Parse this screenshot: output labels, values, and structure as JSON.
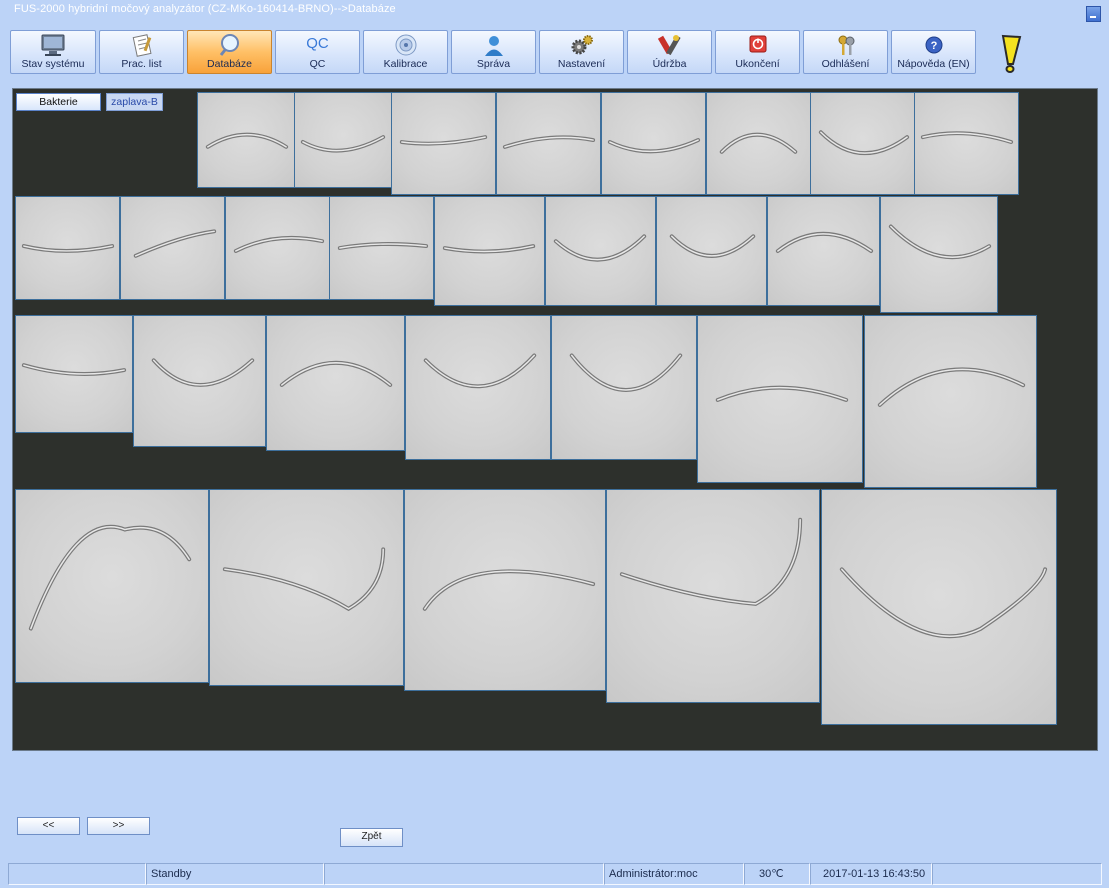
{
  "window": {
    "title": "FUS-2000 hybridní močový analyzátor (CZ-MKo-160414-BRNO)-->Databáze"
  },
  "toolbar": {
    "items": [
      {
        "label": "Stav systému",
        "icon": "monitor-icon"
      },
      {
        "label": "Prac. list",
        "icon": "worklist-icon"
      },
      {
        "label": "Databáze",
        "icon": "magnifier-icon",
        "active": true
      },
      {
        "label": "QC",
        "icon": "qc-icon"
      },
      {
        "label": "Kalibrace",
        "icon": "target-icon"
      },
      {
        "label": "Správa",
        "icon": "user-icon"
      },
      {
        "label": "Nastavení",
        "icon": "gears-icon"
      },
      {
        "label": "Údržba",
        "icon": "tools-icon"
      },
      {
        "label": "Ukončení",
        "icon": "power-icon"
      },
      {
        "label": "Odhlášení",
        "icon": "keys-icon"
      },
      {
        "label": "Nápověda (EN)",
        "icon": "help-icon"
      }
    ],
    "qc_icon_text": "QC",
    "warning_icon": "warning-icon"
  },
  "viewer": {
    "tabs": [
      {
        "label": "Bakterie"
      },
      {
        "label": "zaplava-B"
      }
    ]
  },
  "nav": {
    "prev_label": "<<",
    "next_label": ">>",
    "back_label": "Zpět"
  },
  "status": {
    "state": "Standby",
    "user": "Administrátor:moc",
    "temperature": "30℃",
    "datetime": "2017-01-13 16:43:50"
  },
  "colors": {
    "background": "#bcd3f7",
    "viewer_bg": "#2d302c",
    "active_button": "#ffc066",
    "tile_border": "#3d6f9c"
  }
}
